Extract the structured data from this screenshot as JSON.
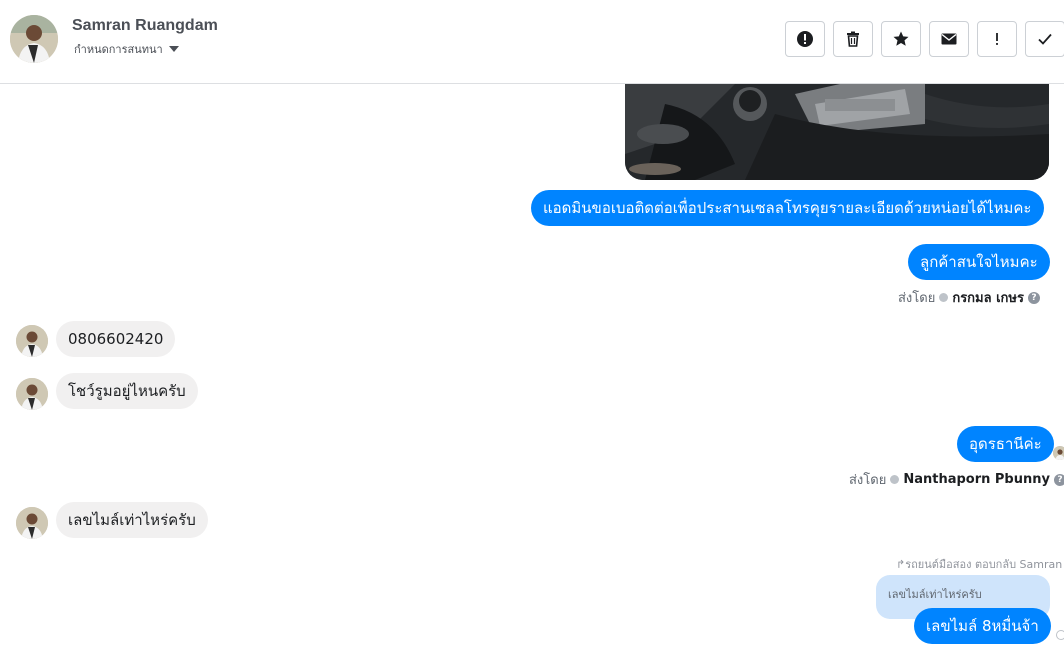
{
  "header": {
    "name": "Samran Ruangdam",
    "subtitle": "กำหนดการสนทนา",
    "toolbar": [
      {
        "icon": "exclamation-circle-icon",
        "label": "mark-as-spam"
      },
      {
        "icon": "trash-icon",
        "label": "delete"
      },
      {
        "icon": "star-icon",
        "label": "star"
      },
      {
        "icon": "envelope-icon",
        "label": "mark-unread"
      },
      {
        "icon": "exclamation-icon",
        "label": "follow-up"
      },
      {
        "icon": "check-icon",
        "label": "done"
      }
    ]
  },
  "messages": {
    "out1": "แอดมินขอเบอติดต่อเพื่อประสานเซลลโทรคุยรายละเอียดด้วยหน่อยได้ไหมคะ",
    "out2": "ลูกค้าสนใจไหมคะ",
    "sent_by_1": {
      "prefix": "ส่งโดย",
      "name": "กรกมล เกษร"
    },
    "in1": "0806602420",
    "in2": "โชว์รูมอยู่ไหนครับ",
    "out3": "อุดรธานีค่ะ",
    "sent_by_2": {
      "prefix": "ส่งโดย",
      "name": "Nanthaporn Pbunny"
    },
    "in3": "เลขไมล์เท่าไหร่ครับ",
    "reply_meta": "↱รถยนต์มือสอง ตอบกลับ Samran",
    "reply_quote": "เลขไมล์เท่าไหร่ครับ",
    "out4": "เลขไมล์ 8หมื่นจ้า"
  },
  "colors": {
    "outgoing_bubble": "#0084ff",
    "incoming_bubble": "#f1f0f0",
    "quote_bubble": "#cfe4fb"
  }
}
